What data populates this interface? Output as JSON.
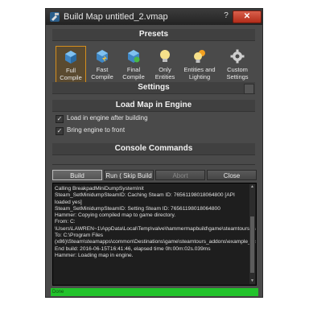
{
  "window": {
    "title": "Build Map untitled_2.vmap",
    "help_label": "?",
    "close_label": "✕"
  },
  "presets": {
    "header": "Presets",
    "items": [
      {
        "label_line1": "Full",
        "label_line2": "Compile",
        "selected": true,
        "icon": "cube-icon"
      },
      {
        "label_line1": "Fast",
        "label_line2": "Compile",
        "selected": false,
        "icon": "cube-fast-icon"
      },
      {
        "label_line1": "Final",
        "label_line2": "Compile",
        "selected": false,
        "icon": "cube-final-icon"
      },
      {
        "label_line1": "Only",
        "label_line2": "Entities",
        "selected": false,
        "icon": "bulb-icon"
      },
      {
        "label_line1": "Entities and",
        "label_line2": "Lighting",
        "selected": false,
        "icon": "bulb-sun-icon"
      },
      {
        "label_line1": "Custom",
        "label_line2": "Settings",
        "selected": false,
        "icon": "gear-icon"
      }
    ]
  },
  "settings": {
    "header": "Settings"
  },
  "load_map": {
    "header": "Load Map in Engine",
    "options": [
      {
        "label": "Load in engine after building",
        "checked": true
      },
      {
        "label": "Bring engine to front",
        "checked": true
      }
    ]
  },
  "console": {
    "header": "Console Commands",
    "buttons": {
      "build": "Build",
      "run": "Run  ( Skip Build )",
      "abort": "Abort",
      "close": "Close"
    },
    "lines": [
      "Calling BreakpadMiniDumpSystemInit",
      "Steam_SetMinidumpSteamID: Caching Steam ID: 76561198018064800 [API loaded yes]",
      "Steam_SetMinidumpSteamID: Setting Steam ID: 76561198018064800",
      "Hammer: Copying compiled map to game directory.",
      "From: C:",
      "\\Users\\LAWREN~1\\AppData\\Local\\Temp\\valve\\hammermapbuild\\game\\steamtours_addons\\example_test\\maps\\untitled_1.vpk",
      "To: C:\\Program Files (x86)\\Steam\\steamapps\\common\\Destinations\\game\\steamtours_addons\\example_test\\maps\\untitled_1.vpk",
      "End build: 2016-06-15T16:41:46, elapsed time 0h:00m:02s.039ms",
      "Hammer: Loading map in engine."
    ]
  },
  "status": {
    "text": "Done",
    "color": "#22c32b"
  }
}
